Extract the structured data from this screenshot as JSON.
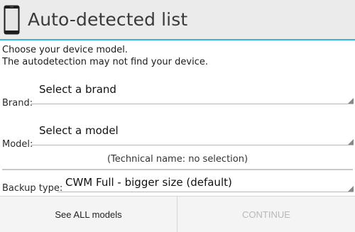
{
  "header": {
    "title": "Auto-detected list",
    "icon": "phone-icon"
  },
  "intro": {
    "line1": "Choose your device model.",
    "line2": "The autodetection may not find your device."
  },
  "brand": {
    "label": "Brand:",
    "value": "Select a brand"
  },
  "model": {
    "label": "Model:",
    "value": "Select a model"
  },
  "technical_name": "(Technical name: no selection)",
  "backup": {
    "label": "Backup type:",
    "value": "CWM Full - bigger size (default)"
  },
  "buttons": {
    "see_all": "See ALL models",
    "continue": "CONTINUE"
  },
  "colors": {
    "accent": "#33b5e5",
    "disabled_text": "#b8b8b8"
  }
}
